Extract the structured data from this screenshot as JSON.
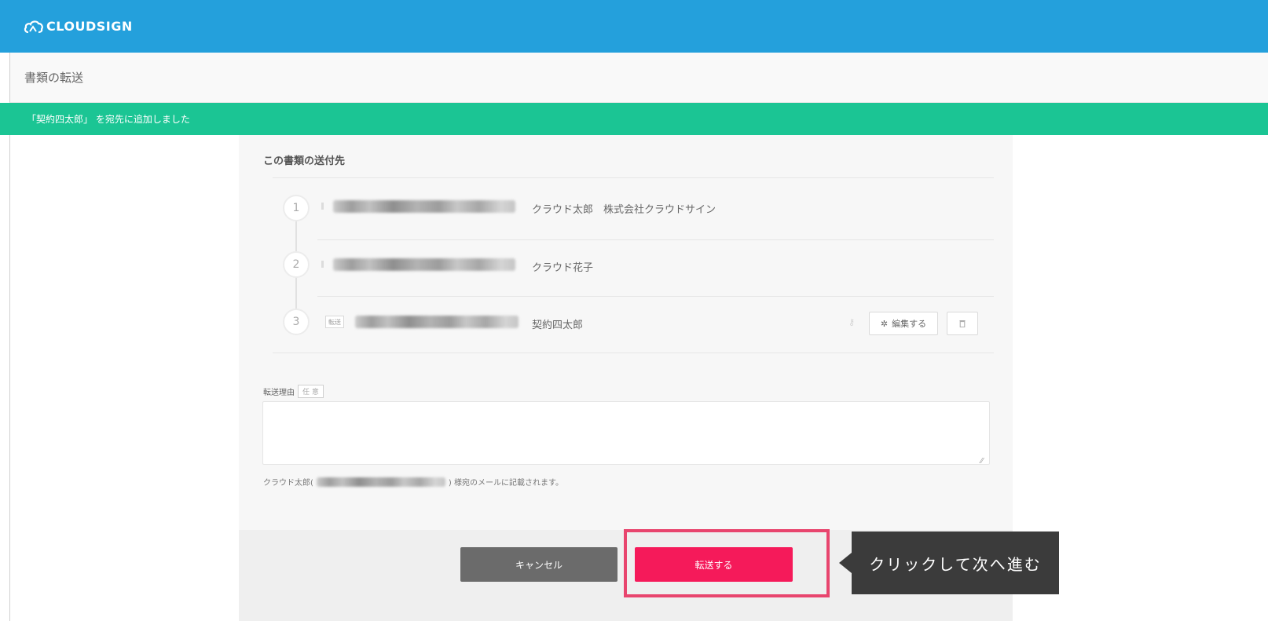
{
  "header": {
    "logo_text": "CLOUDSIGN"
  },
  "page": {
    "title": "書類の転送"
  },
  "notification": {
    "text": "「契約四太郎」 を宛先に追加しました"
  },
  "recipients": {
    "section_title": "この書類の送付先",
    "items": [
      {
        "number": "1",
        "name": "クラウド太郎",
        "company": "株式会社クラウドサイン"
      },
      {
        "number": "2",
        "name": "クラウド花子",
        "company": ""
      },
      {
        "number": "3",
        "tag": "転送",
        "name": "契約四太郎",
        "company": "",
        "edit_label": "編集する"
      }
    ]
  },
  "reason": {
    "label": "転送理由",
    "optional_label": "任 意",
    "value": ""
  },
  "note": {
    "prefix": "クラウド太郎(",
    "suffix": ") 様宛のメールに記載されます。"
  },
  "actions": {
    "cancel_label": "キャンセル",
    "send_label": "転送する"
  },
  "callout": {
    "text": "クリックして次へ進む"
  },
  "colors": {
    "header_bg": "#24a0dc",
    "notice_bg": "#1bc594",
    "primary": "#f51a5a",
    "highlight": "#e8456e"
  }
}
